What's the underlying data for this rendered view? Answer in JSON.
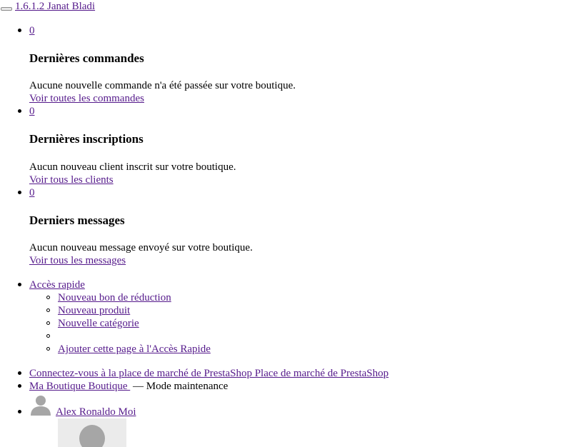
{
  "header": {
    "version_link": "1.6.1.2 Janat Bladi"
  },
  "notifications": [
    {
      "count": "0",
      "title": "Dernières commandes",
      "message": "Aucune nouvelle commande n'a été passée sur votre boutique.",
      "link": "Voir toutes les commandes"
    },
    {
      "count": "0",
      "title": "Dernières inscriptions",
      "message": "Aucun nouveau client inscrit sur votre boutique.",
      "link": "Voir tous les clients"
    },
    {
      "count": "0",
      "title": "Derniers messages",
      "message": "Aucun nouveau message envoyé sur votre boutique.",
      "link": "Voir tous les messages"
    }
  ],
  "quick_access": {
    "label": "Accès rapide",
    "items": [
      "Nouveau bon de réduction",
      "Nouveau produit",
      "Nouvelle catégorie",
      "",
      "Ajouter cette page à l'Accès Rapide"
    ]
  },
  "marketplace": {
    "link": "Connectez-vous à la place de marché de PrestaShop Place de marché de PrestaShop"
  },
  "shop": {
    "link": "Ma Boutique Boutique ",
    "status": "— Mode maintenance"
  },
  "user": {
    "name": "Alex Ronaldo Moi"
  },
  "colors": {
    "link": "#551a8b",
    "text": "#000000",
    "avatar_bg": "#ebebeb",
    "avatar_figure": "#a6a6a6"
  }
}
